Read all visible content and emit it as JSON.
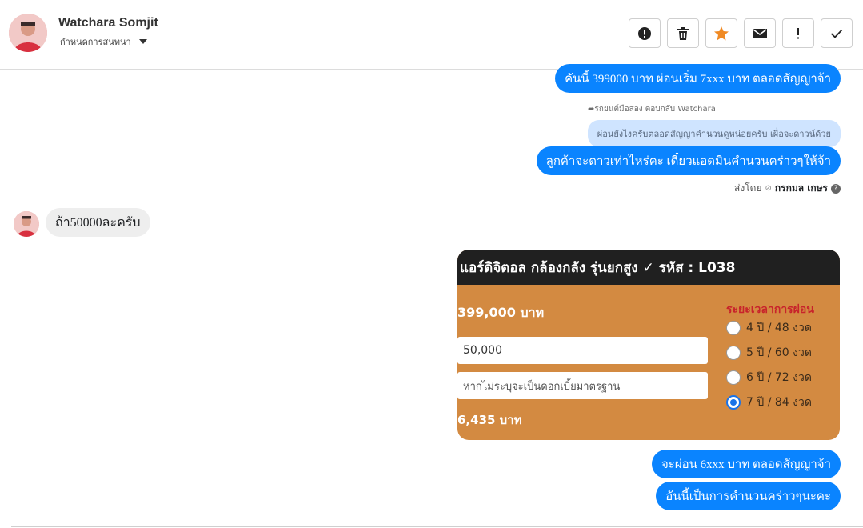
{
  "header": {
    "contact_name": "Watchara Somjit",
    "assign_label": "กำหนดการสนทนา",
    "actions": [
      {
        "icon": "alert-circle-icon"
      },
      {
        "icon": "trash-icon"
      },
      {
        "icon": "star-icon",
        "color": "#f08a24"
      },
      {
        "icon": "mail-icon"
      },
      {
        "icon": "exclamation-icon"
      },
      {
        "icon": "check-icon"
      }
    ]
  },
  "messages": {
    "out1": "คันนี้ 399000 บาท ผ่อนเริ่ม 7xxx บาท ตลอดสัญญาจ้า",
    "reply_meta": "รถยนต์มือสอง ตอบกลับ Watchara",
    "reply_quote": "ผ่อนยังไงครับตลอดสัญญาคำนวนดูหน่อยครับ เผื่อจะดาวน์ด้วย",
    "out2": "ลูกค้าจะดาวเท่าไหร่คะ เดี๋ยวแอดมินคำนวนคร่าวๆให้จ้า",
    "sent_by_prefix": "ส่งโดย",
    "sent_by_name": "กรกมล เกษร",
    "in1": "ถ้า50000ละครับ",
    "out3": "จะผ่อน 6xxx บาท ตลอดสัญญาจ้า",
    "out4": "อันนี้เป็นการคำนวนคร่าวๆนะคะ"
  },
  "card": {
    "title": "แอร์ดิจิตอล กล้องกลัง รุ่นยกสูง ✓ รหัส : L038",
    "price": "399,000 บาท",
    "down_value": "50,000",
    "interest_placeholder": "หากไม่ระบุจะเป็นดอกเบี้ยมาตรฐาน",
    "monthly": "6,435 บาท",
    "term_title": "ระยะเวลาการผ่อน",
    "terms": [
      "4 ปี / 48 งวด",
      "5 ปี / 60 งวด",
      "6 ปี / 72 งวด",
      "7 ปี / 84 งวด"
    ],
    "selected_term": "7 ปี / 84 งวด"
  },
  "colors": {
    "outgoing_bubble": "#0a84ff",
    "incoming_bubble": "#eeeeee",
    "card_bg": "#d38a41",
    "card_header": "#202020",
    "term_title": "#c8232b"
  }
}
